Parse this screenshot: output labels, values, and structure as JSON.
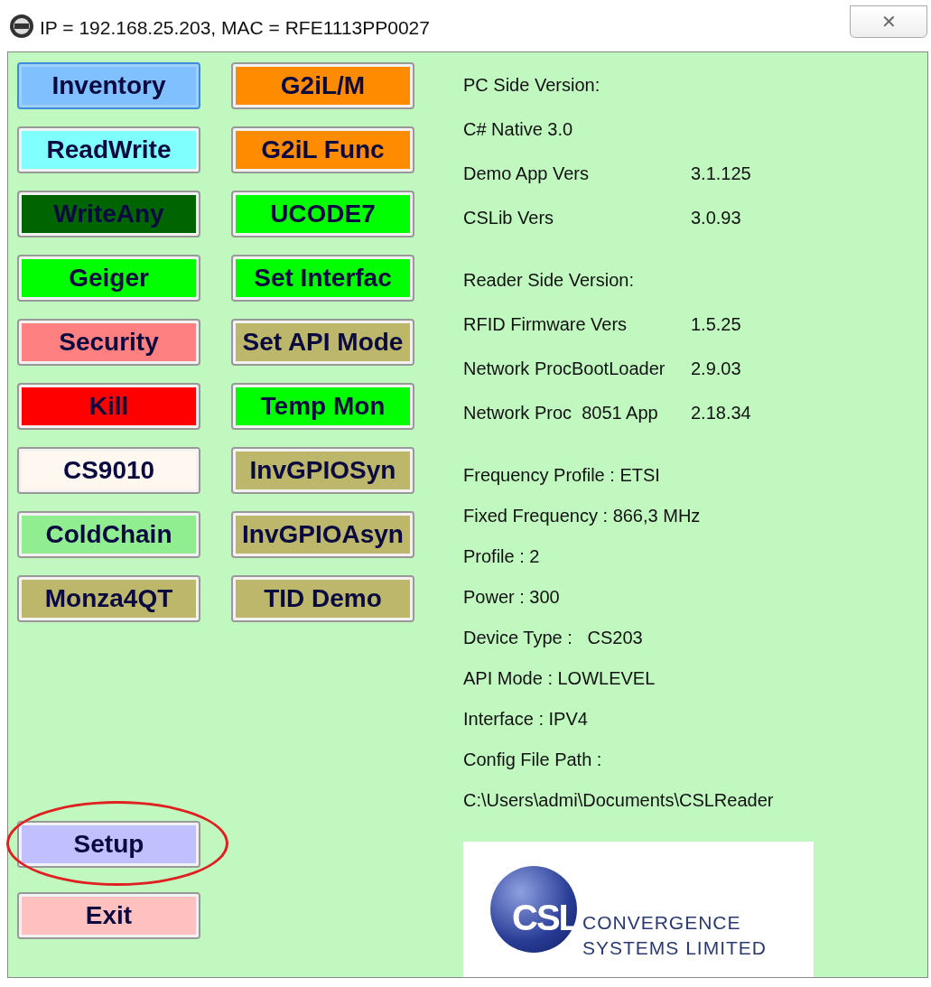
{
  "window": {
    "title": "IP = 192.168.25.203, MAC = RFE1113PP0027",
    "close": "✕"
  },
  "buttons": {
    "left": [
      {
        "label": "Inventory",
        "color": "#80c0ff",
        "focused": true
      },
      {
        "label": "ReadWrite",
        "color": "#80ffff",
        "focused": false
      },
      {
        "label": "WriteAny",
        "color": "#006400",
        "focused": false
      },
      {
        "label": "Geiger",
        "color": "#00ff00",
        "focused": false
      },
      {
        "label": "Security",
        "color": "#ff8080",
        "focused": false
      },
      {
        "label": "Kill",
        "color": "#ff0000",
        "focused": false
      },
      {
        "label": "CS9010",
        "color": "#fff8f0",
        "focused": false
      },
      {
        "label": "ColdChain",
        "color": "#90ee90",
        "focused": false
      },
      {
        "label": "Monza4QT",
        "color": "#bdb76b",
        "focused": false
      }
    ],
    "right": [
      {
        "label": "G2iL/M",
        "color": "#ff8c00",
        "focused": false
      },
      {
        "label": "G2iL Func",
        "color": "#ff8c00",
        "focused": false
      },
      {
        "label": "UCODE7",
        "color": "#00ff00",
        "focused": false
      },
      {
        "label": "Set Interfac",
        "color": "#00ff00",
        "focused": false
      },
      {
        "label": "Set API Mode",
        "color": "#bdb76b",
        "focused": false
      },
      {
        "label": "Temp Mon",
        "color": "#00ff00",
        "focused": false
      },
      {
        "label": "InvGPIOSyn",
        "color": "#bdb76b",
        "focused": false
      },
      {
        "label": "InvGPIOAsyn",
        "color": "#bdb76b",
        "focused": false
      },
      {
        "label": "TID Demo",
        "color": "#bdb76b",
        "focused": false
      }
    ],
    "bottom": [
      {
        "label": "Setup",
        "color": "#c0c0ff",
        "focused": false,
        "highlighted": true
      },
      {
        "label": "Exit",
        "color": "#ffc0c0",
        "focused": false,
        "highlighted": false
      }
    ]
  },
  "info_sections": [
    [
      {
        "label": "PC Side Version:"
      },
      {
        "label": "C# Native 3.0"
      },
      {
        "label": "Demo App Vers",
        "value": "3.1.125"
      },
      {
        "label": "CSLib Vers",
        "value": "3.0.93"
      }
    ],
    [
      {
        "label": "Reader Side Version:"
      },
      {
        "label": "RFID Firmware Vers",
        "value": "1.5.25"
      },
      {
        "label": "Network ProcBootLoader",
        "value": "2.9.03"
      },
      {
        "label": "Network Proc  8051 App",
        "value": "2.18.34"
      }
    ],
    [
      {
        "label": "Frequency Profile : ETSI"
      },
      {
        "label": "Fixed Frequency : 866,3 MHz"
      },
      {
        "label": "Profile : 2"
      },
      {
        "label": "Power : 300"
      },
      {
        "label": "Device Type :   CS203"
      },
      {
        "label": "API Mode : LOWLEVEL"
      },
      {
        "label": "Interface : IPV4"
      },
      {
        "label": "Config File Path :"
      },
      {
        "label": "C:\\Users\\admi\\Documents\\CSLReader"
      }
    ]
  ],
  "logo": {
    "mark": "CSL",
    "line_1": "CONVERGENCE",
    "line_2": "SYSTEMS LIMITED"
  }
}
